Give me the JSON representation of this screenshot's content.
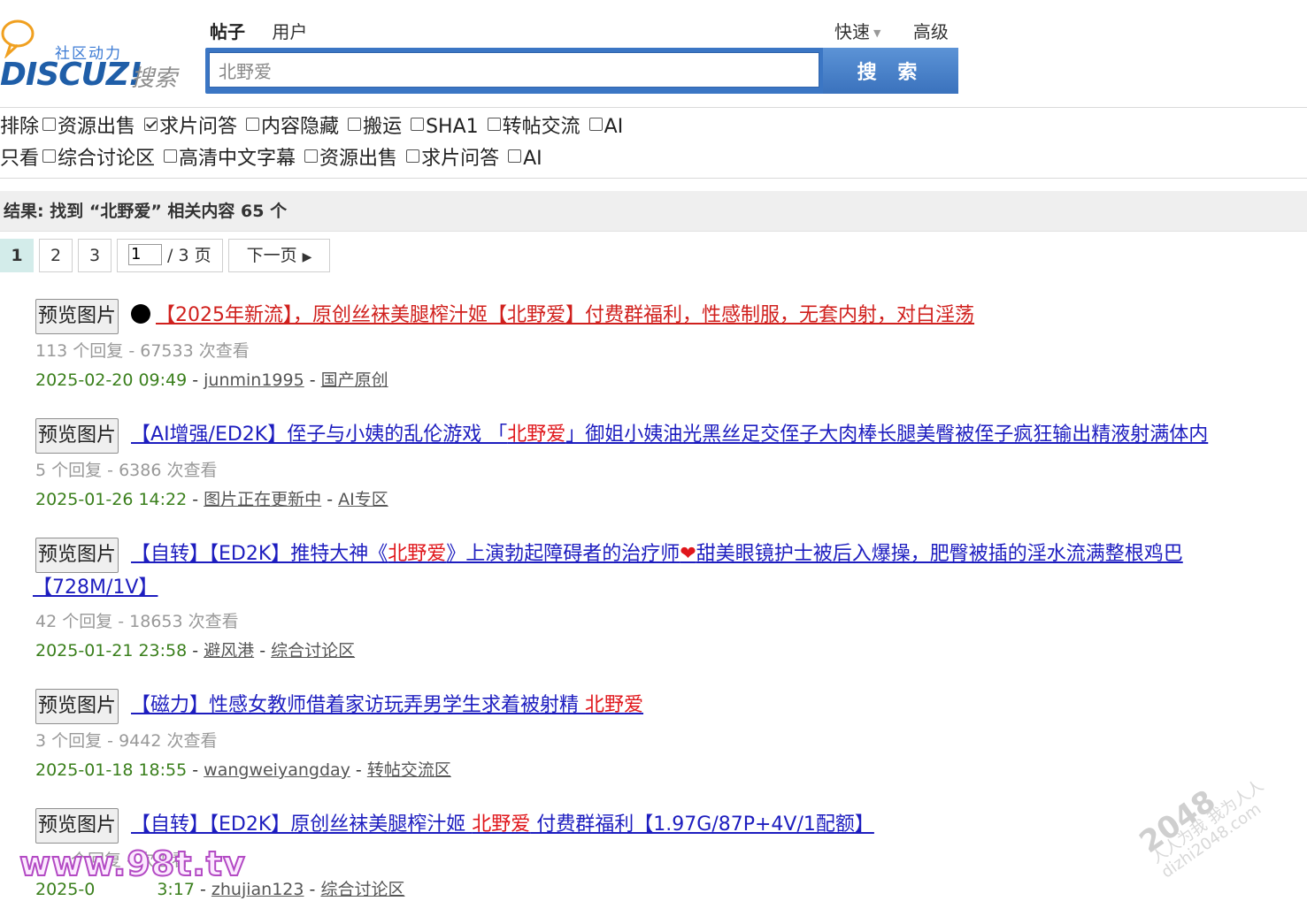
{
  "logo": {
    "tagline": "社区动力",
    "brand": "DISCUZ!",
    "search_word": "搜索"
  },
  "tabs": [
    "帖子",
    "用户"
  ],
  "quick_links": {
    "quick": "快速",
    "advanced": "高级"
  },
  "search": {
    "value": "北野爱",
    "button_label": "搜 索"
  },
  "filters": {
    "exclude_label": "排除",
    "exclude_options": [
      {
        "label": "资源出售",
        "checked": false
      },
      {
        "label": "求片问答",
        "checked": true
      },
      {
        "label": "内容隐藏",
        "checked": false
      },
      {
        "label": "搬运",
        "checked": false
      },
      {
        "label": "SHA1",
        "checked": false
      },
      {
        "label": "转帖交流",
        "checked": false
      },
      {
        "label": "AI",
        "checked": false
      }
    ],
    "only_label": "只看",
    "only_options": [
      {
        "label": "综合讨论区",
        "checked": false
      },
      {
        "label": "高清中文字幕",
        "checked": false
      },
      {
        "label": "资源出售",
        "checked": false
      },
      {
        "label": "求片问答",
        "checked": false
      },
      {
        "label": "AI",
        "checked": false
      }
    ]
  },
  "result_summary": "结果: 找到 “北野爱” 相关内容 65 个",
  "pager": {
    "pages": [
      "1",
      "2",
      "3"
    ],
    "current": "1",
    "jump_value": "1",
    "total_label": "/ 3 页",
    "next_label": "下一页"
  },
  "preview_label": "预览图片",
  "results": [
    {
      "title_parts": [
        "【2025年新流】，原创丝袜美腿榨汁姬【",
        "北野爱",
        "】付费群福利，性感制服，无套内射，对白淫荡"
      ],
      "stats": "113 个回复 - 67533 次查看",
      "date": "2025-02-20 09:49",
      "author": "junmin1995",
      "forum": "国产原创"
    },
    {
      "title_parts": [
        "【AI增强/ED2K】侄子与小姨的乱伦游戏 「",
        "北野爱",
        "」御姐小姨油光黑丝足交侄子大肉棒长腿美臀被侄子疯狂输出精液射满体内"
      ],
      "stats": "5 个回复 - 6386 次查看",
      "date": "2025-01-26 14:22",
      "author": "图片正在更新中",
      "forum": "AI专区"
    },
    {
      "title_parts": [
        "【自转】【ED2K】推特大神《",
        "北野爱",
        "》上演勃起障碍者的治疗师",
        "甜美眼镜护士被后入爆操，肥臀被插的淫水流满整根鸡巴",
        "【728M/1V】"
      ],
      "stats": "42 个回复 - 18653 次查看",
      "date": "2025-01-21 23:58",
      "author": "避风港",
      "forum": "综合讨论区"
    },
    {
      "title_parts": [
        "【磁力】性感女教师借着家访玩弄男学生求着被射精 ",
        "北野爱"
      ],
      "stats": "3 个回复 - 9442 次查看",
      "date": "2025-01-18 18:55",
      "author": "wangweiyangday",
      "forum": "转帖交流区"
    },
    {
      "title_parts": [
        "【自转】【ED2K】原创丝袜美腿榨汁姬 ",
        "北野爱",
        " 付费群福利【1.97G/87P+4V/1配额】"
      ],
      "stats": "个回复 - 次查看",
      "date": "2025-0",
      "date_tail": "3:17",
      "author": "zhujian123",
      "forum": "综合讨论区"
    }
  ],
  "watermarks": {
    "left": "www.98t.tv",
    "right_big": "2048",
    "right_line1": "人人为我 我为人人",
    "right_line2": "dizhi2048.com"
  }
}
